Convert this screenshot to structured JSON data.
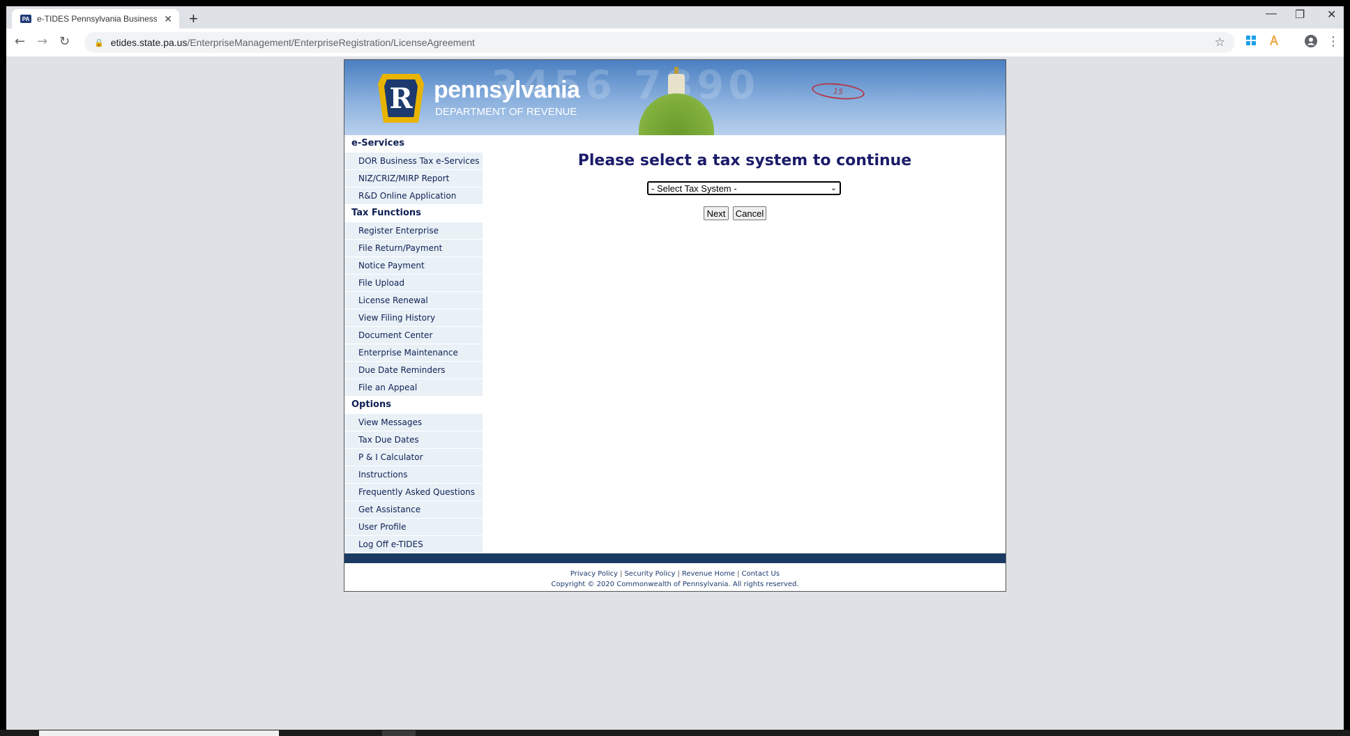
{
  "browser": {
    "tab_title": "e-TIDES Pennsylvania Business Ta",
    "favicon_text": "PA",
    "tab_close": "✕",
    "new_tab": "+",
    "window_controls": {
      "minimize": "—",
      "restore": "❐",
      "close": "✕"
    },
    "nav": {
      "back": "←",
      "forward": "→",
      "reload": "↻"
    },
    "url_host": "etides.state.pa.us",
    "url_path": "/EnterpriseManagement/EnterpriseRegistration/LicenseAgreement",
    "lock_icon": "🔒",
    "bookmark_star": "☆",
    "menu_dots": "⋮"
  },
  "banner": {
    "logo_letter": "R",
    "brand_name": "pennsylvania",
    "department": "DEPARTMENT OF REVENUE",
    "background_digits": "3456 7890",
    "stamp": "15"
  },
  "sidebar": {
    "sections": [
      {
        "title": "e-Services",
        "items": [
          "DOR Business Tax e-Services",
          "NIZ/CRIZ/MIRP Report",
          "R&D Online Application"
        ]
      },
      {
        "title": "Tax Functions",
        "items": [
          "Register Enterprise",
          "File Return/Payment",
          "Notice Payment",
          "File Upload",
          "License Renewal",
          "View Filing History",
          "Document Center",
          "Enterprise Maintenance",
          "Due Date Reminders",
          "File an Appeal"
        ]
      },
      {
        "title": "Options",
        "items": [
          "View Messages",
          "Tax Due Dates",
          "P & I Calculator",
          "Instructions",
          "Frequently Asked Questions",
          "Get Assistance",
          "User Profile",
          "Log Off e-TIDES"
        ]
      }
    ]
  },
  "main": {
    "title": "Please select a tax system to continue",
    "select_value": "- Select Tax System -",
    "next_label": "Next",
    "cancel_label": "Cancel"
  },
  "footer": {
    "links": [
      "Privacy Policy",
      "Security Policy",
      "Revenue Home",
      "Contact Us"
    ],
    "copyright": "Copyright © 2020 Commonwealth of Pennsylvania. All rights reserved."
  },
  "colors": {
    "title": "#1b1b6a",
    "menu_bg": "#e9f1f7",
    "footer_bar": "#1a3a63",
    "keystone": "#e8b400"
  }
}
